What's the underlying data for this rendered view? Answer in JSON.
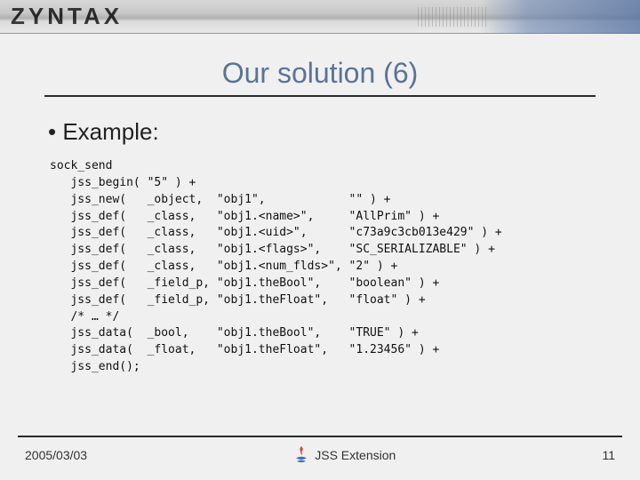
{
  "brand": "ZYNTAX",
  "title": "Our solution (6)",
  "bullet": "Example:",
  "code": "sock_send\n   jss_begin( \"5\" ) +\n   jss_new(   _object,  \"obj1\",            \"\" ) +\n   jss_def(   _class,   \"obj1.<name>\",     \"AllPrim\" ) +\n   jss_def(   _class,   \"obj1.<uid>\",      \"c73a9c3cb013e429\" ) +\n   jss_def(   _class,   \"obj1.<flags>\",    \"SC_SERIALIZABLE\" ) +\n   jss_def(   _class,   \"obj1.<num_flds>\", \"2\" ) +\n   jss_def(   _field_p, \"obj1.theBool\",    \"boolean\" ) +\n   jss_def(   _field_p, \"obj1.theFloat\",   \"float\" ) +\n   /* … */\n   jss_data(  _bool,    \"obj1.theBool\",    \"TRUE\" ) +\n   jss_data(  _float,   \"obj1.theFloat\",   \"1.23456\" ) +\n   jss_end();",
  "footer": {
    "date": "2005/03/03",
    "center": "JSS Extension",
    "page": "11"
  },
  "icons": {
    "java": "java-duke-icon"
  }
}
